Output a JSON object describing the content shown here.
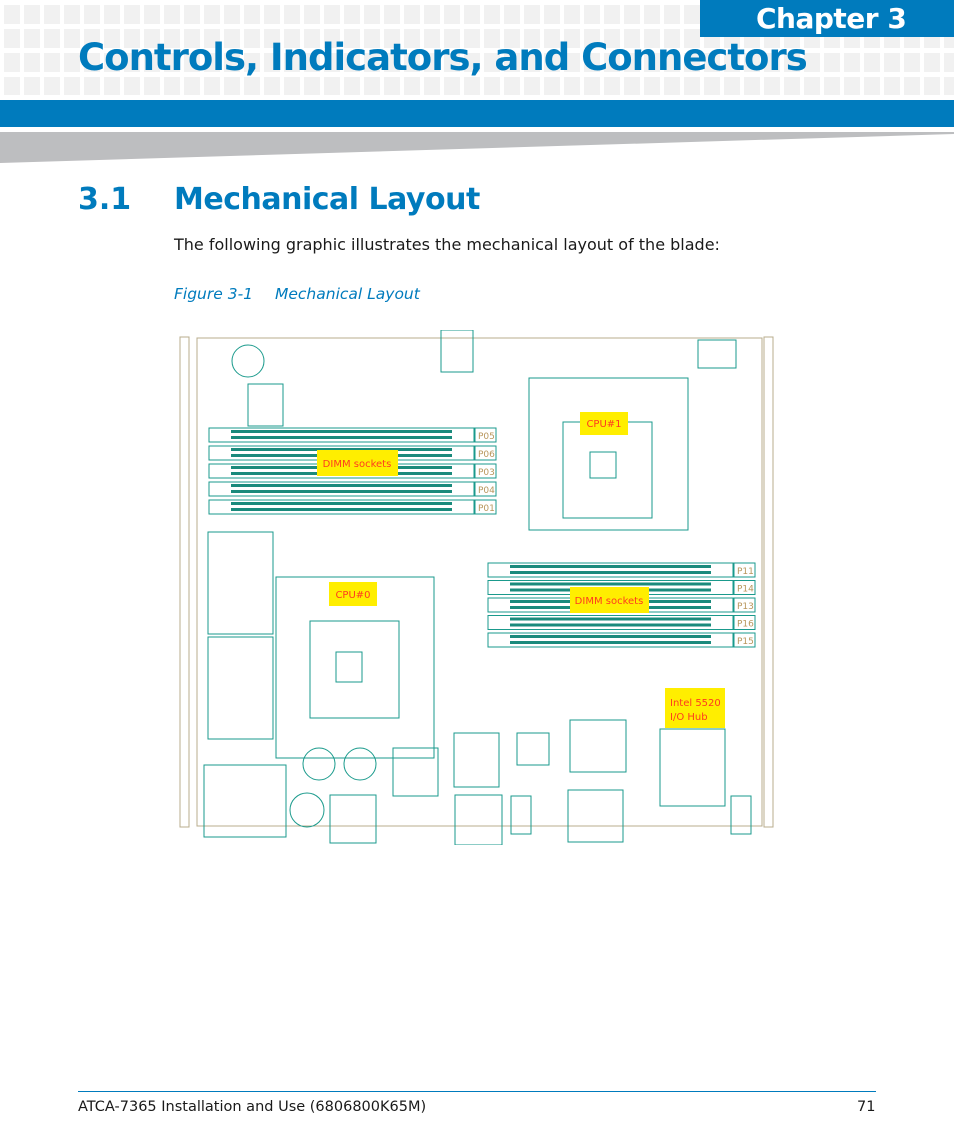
{
  "header": {
    "chapter_label": "Chapter 3",
    "chapter_title": "Controls, Indicators, and Connectors",
    "accent_color": "#007bbd"
  },
  "section": {
    "number": "3.1",
    "title": "Mechanical Layout",
    "body": "The following graphic illustrates the mechanical layout of the blade:"
  },
  "figure": {
    "number": "Figure 3-1",
    "title": "Mechanical Layout",
    "labels": {
      "cpu1": "CPU#1",
      "cpu0": "CPU#0",
      "dimm_top": "DIMM sockets",
      "dimm_bottom": "DIMM sockets",
      "ioh_line1": "Intel 5520",
      "ioh_line2": "I/O Hub"
    },
    "dimm_top_slots": [
      "P05",
      "P06",
      "P03",
      "P04",
      "P01"
    ],
    "dimm_bottom_slots": [
      "P11",
      "P14",
      "P13",
      "P16",
      "P15"
    ],
    "highlight_color": "#ffee00",
    "label_color": "#ff3b1f",
    "pcb_line_color": "#1a9a8c"
  },
  "footer": {
    "doc_title": "ATCA-7365 Installation and Use (6806800K65M)",
    "page_number": "71"
  }
}
